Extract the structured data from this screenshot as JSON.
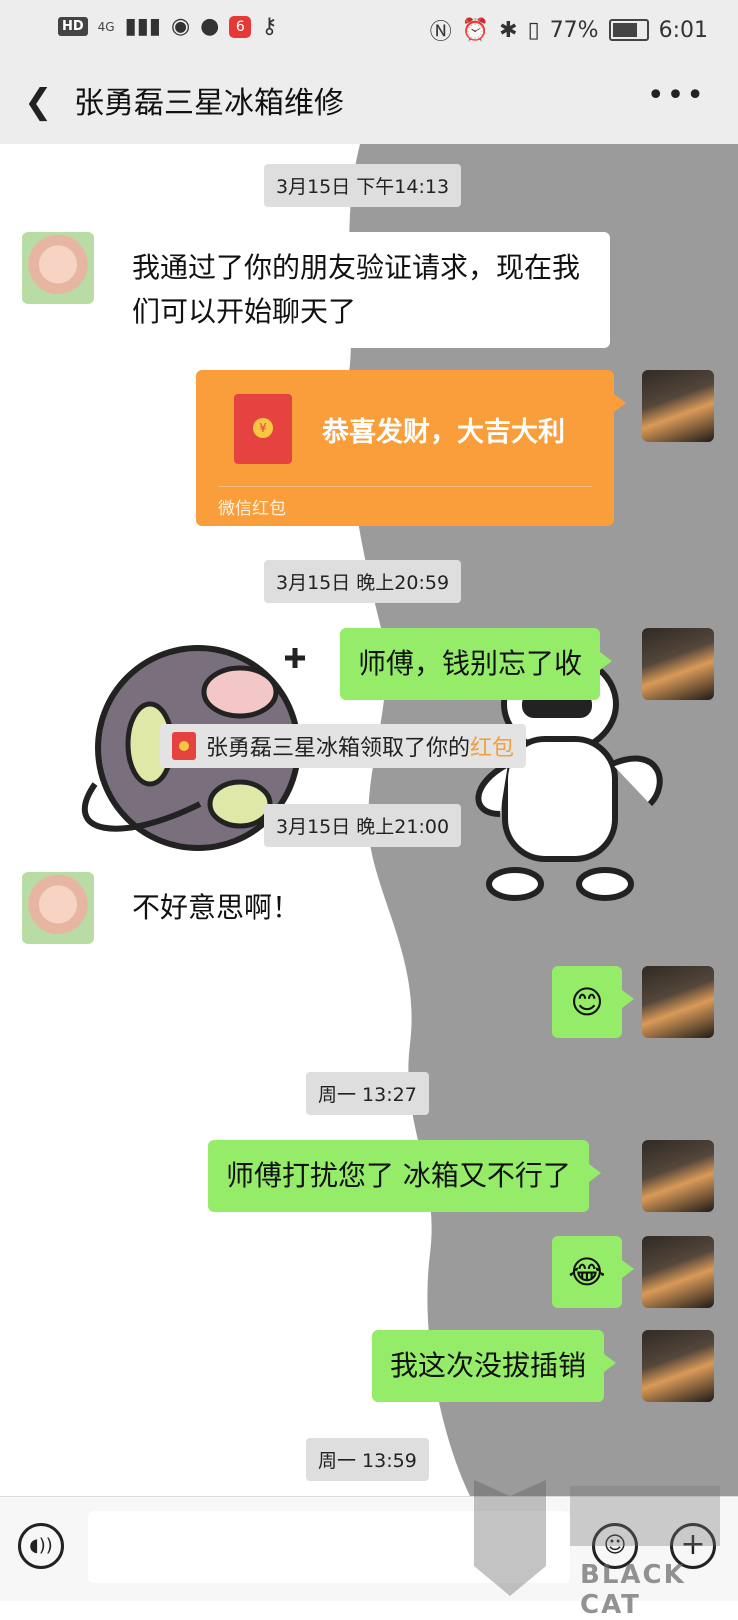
{
  "status_bar": {
    "hd": "HD",
    "network": "4G",
    "app_badge": "6",
    "battery": "77%",
    "time": "6:01"
  },
  "header": {
    "back_icon": "chevron-left-icon",
    "title": "张勇磊三星冰箱维修",
    "more_icon": "more-dots-icon"
  },
  "messages": {
    "t1": "3月15日 下午14:13",
    "m1": "我通过了你的朋友验证请求，现在我们可以开始聊天了",
    "packet_title": "恭喜发财，大吉大利",
    "packet_label": "微信红包",
    "t2": "3月15日 晚上20:59",
    "m2": "师傅，钱别忘了收",
    "notice_text": "张勇磊三星冰箱领取了你的",
    "notice_link": "红包",
    "t3": "3月15日 晚上21:00",
    "m3": "不好意思啊！",
    "m4_emoji": "😊",
    "t4": "周一 13:27",
    "m5": "师傅打扰您了 冰箱又不行了",
    "m6_emoji": "😂",
    "m7": "我这次没拔插销",
    "t5": "周一 13:59"
  },
  "input_bar": {
    "voice_icon": "voice-icon",
    "emoji_icon": "emoji-icon",
    "plus_icon": "plus-icon"
  },
  "watermark": {
    "text": "BLACK CAT"
  },
  "colors": {
    "header_bg": "#ededed",
    "bubble_green": "#95ec69",
    "packet_orange": "#fa9d3b",
    "packet_red": "#e64340"
  }
}
